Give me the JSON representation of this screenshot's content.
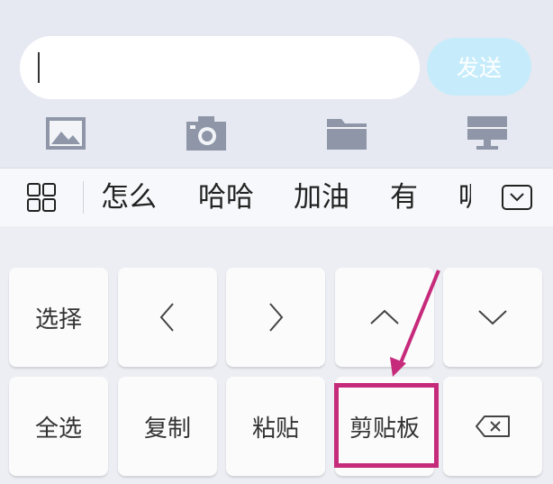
{
  "input": {
    "value": "",
    "send_label": "发送"
  },
  "toolbar": {
    "icons": [
      "image-icon",
      "camera-icon",
      "folder-icon",
      "desktop-icon"
    ]
  },
  "suggestions": {
    "candidates": [
      "怎么",
      "哈哈",
      "加油",
      "有",
      "呢"
    ]
  },
  "keyboard": {
    "row1": {
      "select_label": "选择",
      "left_label": "<",
      "right_label": ">",
      "up_label": "^",
      "down_label": "v"
    },
    "row2": {
      "select_all_label": "全选",
      "copy_label": "复制",
      "paste_label": "粘贴",
      "clipboard_label": "剪贴板",
      "delete_icon": "backspace-icon"
    }
  },
  "colors": {
    "send_button_bg": "#c6ecfb",
    "highlight": "#c62a7a",
    "chat_bg": "#e6e9f2"
  }
}
